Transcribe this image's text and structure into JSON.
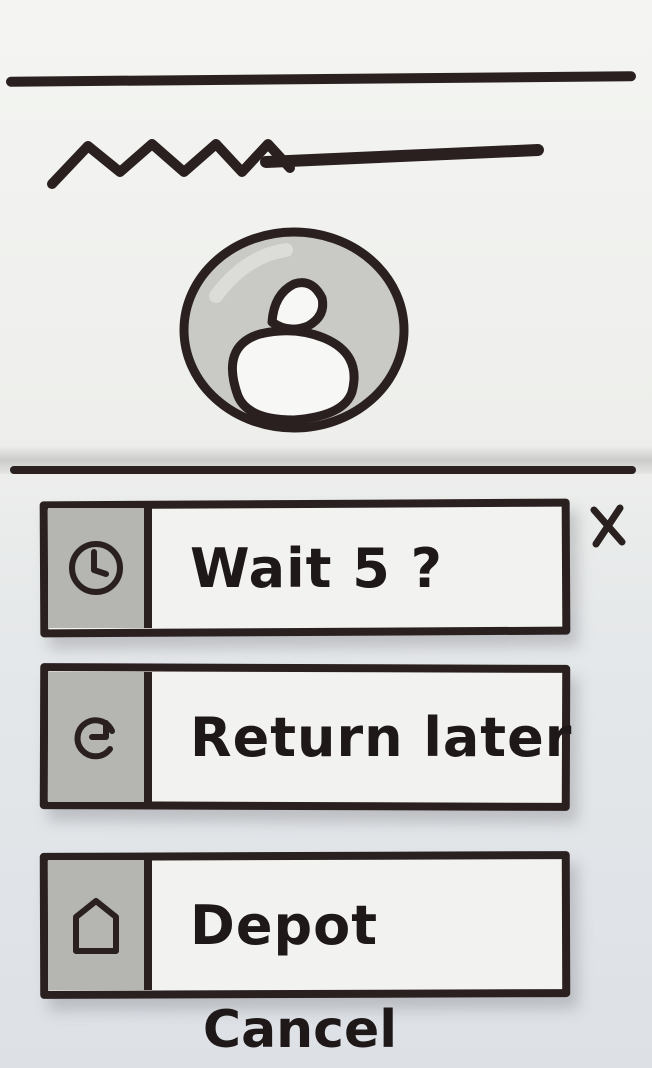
{
  "header": {
    "title_icon": "scribble-title-placeholder"
  },
  "avatar": {
    "icon": "user-avatar-icon"
  },
  "dialog": {
    "close_label": "X",
    "options": [
      {
        "label": "Wait 5 ?",
        "icon": "clock-icon"
      },
      {
        "label": "Return later",
        "icon": "return-icon"
      },
      {
        "label": "Depot",
        "icon": "home-icon"
      }
    ],
    "cancel_label": "Cancel"
  },
  "colors": {
    "ink": "#2a2020",
    "icon_cell": "#b5b5b2",
    "avatar_fill": "#c9c9c6",
    "paper": "#f2f2f0"
  }
}
